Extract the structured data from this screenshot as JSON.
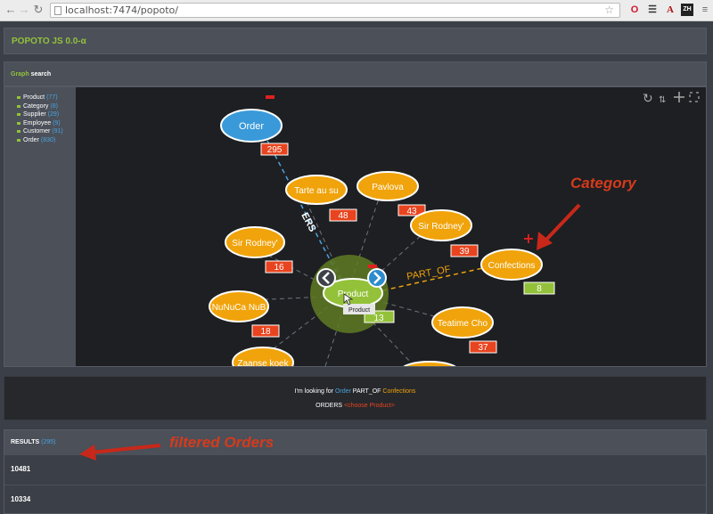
{
  "browser": {
    "url": "localhost:7474/popoto/",
    "ext_opera": "O",
    "ext_a": "A",
    "ext_zh": "ZH"
  },
  "app": {
    "title": "POPOTO JS 0.0-α"
  },
  "graph_panel": {
    "title_accent": "Graph",
    "title_rest": " search"
  },
  "taxonomy": [
    {
      "label": "Product",
      "count": "(77)"
    },
    {
      "label": "Category",
      "count": "(8)"
    },
    {
      "label": "Supplier",
      "count": "(29)"
    },
    {
      "label": "Employee",
      "count": "(9)"
    },
    {
      "label": "Customer",
      "count": "(91)"
    },
    {
      "label": "Order",
      "count": "(830)"
    }
  ],
  "graph": {
    "nodes": [
      {
        "id": "order",
        "label": "Order",
        "count": "295",
        "color": "#3a9ad9"
      },
      {
        "id": "tarte",
        "label": "Tarte au su",
        "count": "48",
        "color": "#f0a30a"
      },
      {
        "id": "pavlova",
        "label": "Pavlova",
        "count": "43",
        "color": "#f0a30a"
      },
      {
        "id": "sirrodney2",
        "label": "Sir Rodney'",
        "count": "39",
        "color": "#f0a30a"
      },
      {
        "id": "sirrodney1",
        "label": "Sir Rodney'",
        "count": "16",
        "color": "#f0a30a"
      },
      {
        "id": "nunuca",
        "label": "NuNuCa NuB",
        "count": "18",
        "color": "#f0a30a"
      },
      {
        "id": "teatime",
        "label": "Teatime Cho",
        "count": "37",
        "color": "#f0a30a"
      },
      {
        "id": "zaanse",
        "label": "Zaanse koek",
        "count": "",
        "color": "#f0a30a"
      },
      {
        "id": "confections",
        "label": "Confections",
        "count": "8",
        "color": "#f0a30a"
      },
      {
        "id": "product",
        "label": "Product",
        "count": "13",
        "color": "#93c23a"
      }
    ],
    "relation_orders": "ERS",
    "relation_partof": "PART_OF",
    "tooltip": "Product",
    "colors": {
      "value": "#f0a30a",
      "root": "#93c23a",
      "order": "#3a9ad9",
      "count_bg": "#e8441f"
    }
  },
  "query": {
    "line1_prefix": "I'm looking for ",
    "line1_entity": "Order",
    "line1_rel": " PART_OF ",
    "line1_value": "Confections",
    "line2_prefix": "ORDERS ",
    "line2_choose": "<choose Product>"
  },
  "results": {
    "title": "RESULTS",
    "count": "(295)",
    "rows": [
      "10481",
      "10334"
    ]
  },
  "annotations": {
    "category": "Category",
    "filtered_orders": "filtered Orders"
  }
}
